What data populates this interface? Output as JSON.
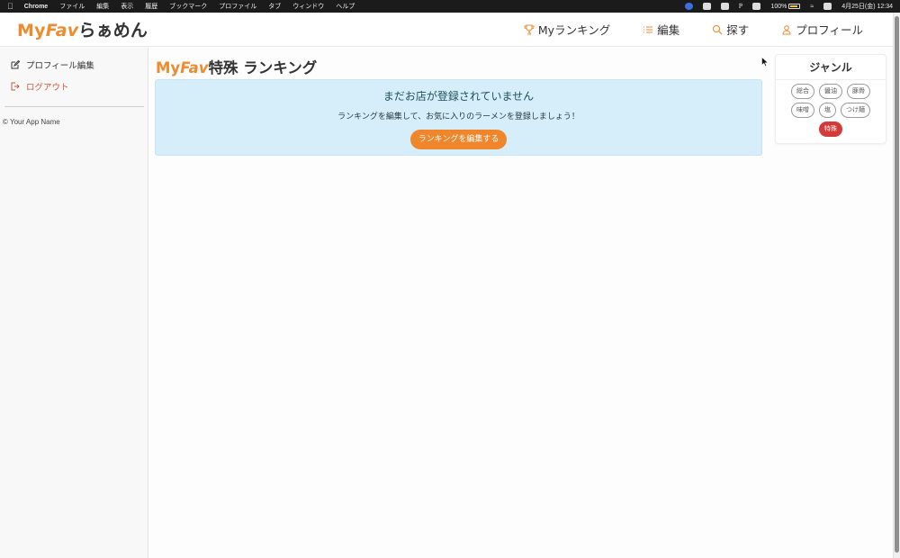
{
  "menubar": {
    "app": "Chrome",
    "items": [
      "ファイル",
      "編集",
      "表示",
      "履歴",
      "ブックマーク",
      "プロファイル",
      "タブ",
      "ウィンドウ",
      "ヘルプ"
    ],
    "battery": "100%",
    "date_time": "4月25日(金)  12:34"
  },
  "header": {
    "brand_part1": "My",
    "brand_part2": "Fav",
    "brand_part3": "らぁめん",
    "nav": {
      "ranking": "Myランキング",
      "edit": "編集",
      "search": "探す",
      "profile": "プロフィール"
    }
  },
  "sidebar": {
    "edit_profile": "プロフィール編集",
    "logout": "ログアウト",
    "copyright": "© Your App Name"
  },
  "main": {
    "title_part1": "My",
    "title_part2": "Fav",
    "title_part3": "特殊 ランキング",
    "alert": {
      "title": "まだお店が登録されていません",
      "text": "ランキングを編集して、お気に入りのラーメンを登録しましょう！",
      "button": "ランキングを編集する"
    }
  },
  "genre": {
    "title": "ジャンル",
    "tags": [
      "総合",
      "醤油",
      "豚骨",
      "味噌",
      "塩",
      "つけ麺",
      "特殊"
    ],
    "active_tag": "特殊"
  },
  "colors": {
    "accent": "#ef8a2f",
    "active_tag": "#d33b3b",
    "alert_bg": "#d6eef9",
    "logout": "#d2553b"
  }
}
